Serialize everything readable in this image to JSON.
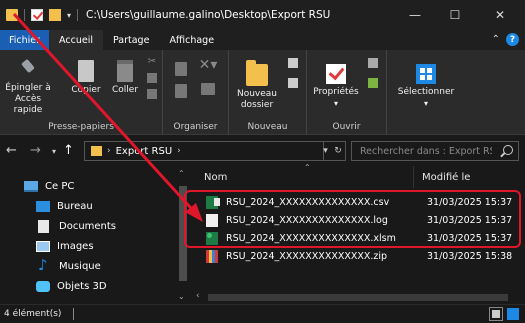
{
  "window": {
    "title": "C:\\Users\\guillaume.galino\\Desktop\\Export RSU",
    "minimize": "—",
    "maximize": "☐",
    "close": "✕"
  },
  "ribbon_tabs": [
    "Fichier",
    "Accueil",
    "Partage",
    "Affichage"
  ],
  "ribbon": {
    "clipboard": {
      "pin_label": "Épingler à\nAccès rapide",
      "pin_line1": "Épingler à",
      "pin_line2": "Accès rapide",
      "copy": "Copier",
      "paste": "Coller",
      "group": "Presse-papiers"
    },
    "organize": {
      "group": "Organiser"
    },
    "new": {
      "new_folder_line1": "Nouveau",
      "new_folder_line2": "dossier",
      "group": "Nouveau"
    },
    "open": {
      "properties": "Propriétés",
      "group": "Ouvrir"
    },
    "select": {
      "select_label": "Sélectionner"
    }
  },
  "address": {
    "crumb": "Export RSU",
    "search_placeholder": "Rechercher dans : Export RSU"
  },
  "nav_pane": {
    "items": [
      "Ce PC",
      "Bureau",
      "Documents",
      "Images",
      "Musique",
      "Objets 3D"
    ]
  },
  "file_list": {
    "columns": [
      "Nom",
      "Modifié le"
    ],
    "files": [
      {
        "name": "RSU_2024_XXXXXXXXXXXXXX.csv",
        "modified": "31/03/2025 15:37",
        "icon": "csv-file-icon"
      },
      {
        "name": "RSU_2024_XXXXXXXXXXXXXX.log",
        "modified": "31/03/2025 15:37",
        "icon": "log-file-icon"
      },
      {
        "name": "RSU_2024_XXXXXXXXXXXXXX.xlsm",
        "modified": "31/03/2025 15:37",
        "icon": "excel-file-icon"
      },
      {
        "name": "RSU_2024_XXXXXXXXXXXXXX.zip",
        "modified": "31/03/2025 15:38",
        "icon": "zip-file-icon"
      }
    ]
  },
  "status": {
    "count": "4 élément(s)"
  },
  "colors": {
    "accent": "#1a5fb4",
    "highlight": "#e0162b",
    "background": "#191919"
  }
}
